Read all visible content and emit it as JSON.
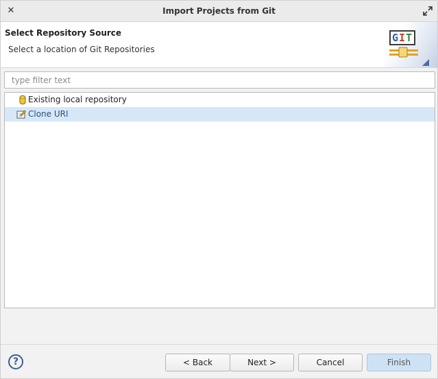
{
  "window": {
    "title": "Import Projects from Git"
  },
  "header": {
    "title": "Select Repository Source",
    "description": "Select a location of Git Repositories",
    "logo_text": "GIT"
  },
  "filter": {
    "placeholder": "type filter text",
    "value": ""
  },
  "tree": {
    "items": [
      {
        "label": "Existing local repository",
        "icon": "repository-cylinder-icon",
        "selected": false
      },
      {
        "label": "Clone URI",
        "icon": "clone-uri-icon",
        "selected": true
      }
    ]
  },
  "footer": {
    "help": "?",
    "back_label": "< Back",
    "next_label": "Next >",
    "cancel_label": "Cancel",
    "finish_label": "Finish"
  },
  "colors": {
    "selection": "#d6e7f8",
    "primary_button": "#cfe2f5",
    "help_icon": "#3d5f8f"
  }
}
